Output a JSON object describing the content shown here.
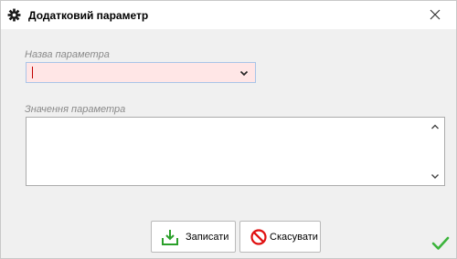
{
  "dialog": {
    "title": "Додатковий параметр",
    "icons": {
      "title": "gear-icon",
      "close": "close-icon",
      "dropdown": "chevron-down-icon",
      "scroll_up": "chevron-up-icon",
      "scroll_down": "chevron-down-icon",
      "confirm": "checkmark-icon"
    }
  },
  "form": {
    "name_label": "Назва параметра",
    "name_value": "",
    "value_label": "Значення параметра",
    "value_text": ""
  },
  "buttons": {
    "save_label": "Записати",
    "save_icon": "download-icon",
    "cancel_label": "Скасувати",
    "cancel_icon": "no-entry-icon"
  },
  "colors": {
    "invalid_field_bg": "#ffe6e6",
    "save_icon": "#2aa02a",
    "cancel_icon": "#e01010",
    "confirm_check": "#3cb43c"
  }
}
